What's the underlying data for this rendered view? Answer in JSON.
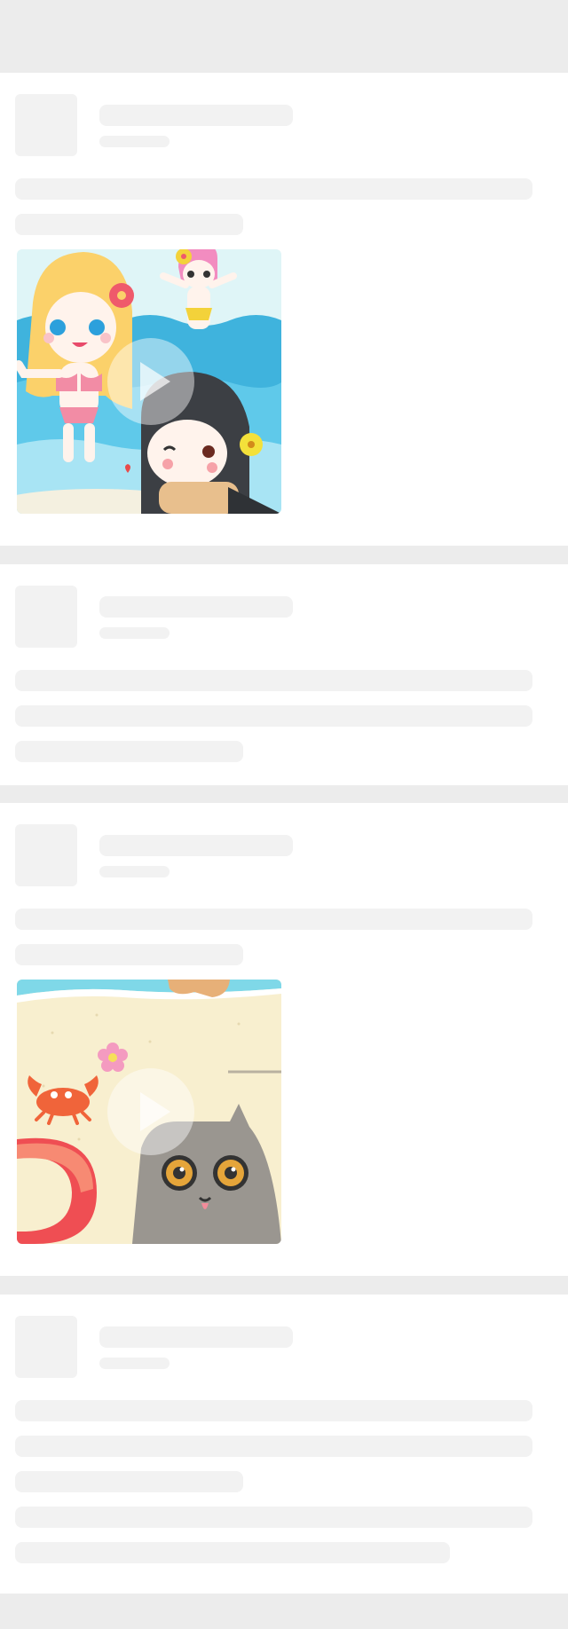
{
  "feed": {
    "posts": [
      {
        "id": "post-1",
        "state": "loading",
        "media": {
          "kind": "video-thumbnail",
          "scene": "beach-girls",
          "play_icon": "play-icon"
        }
      },
      {
        "id": "post-2",
        "state": "loading"
      },
      {
        "id": "post-3",
        "state": "loading",
        "media": {
          "kind": "video-thumbnail",
          "scene": "beach-cat-crab",
          "play_icon": "play-icon"
        }
      },
      {
        "id": "post-4",
        "state": "loading"
      }
    ]
  },
  "colors": {
    "page_bg": "#ececec",
    "card_bg": "#ffffff",
    "skeleton": "#f2f2f2",
    "sea": "#3fb3dd",
    "sand": "#f8efcf"
  }
}
